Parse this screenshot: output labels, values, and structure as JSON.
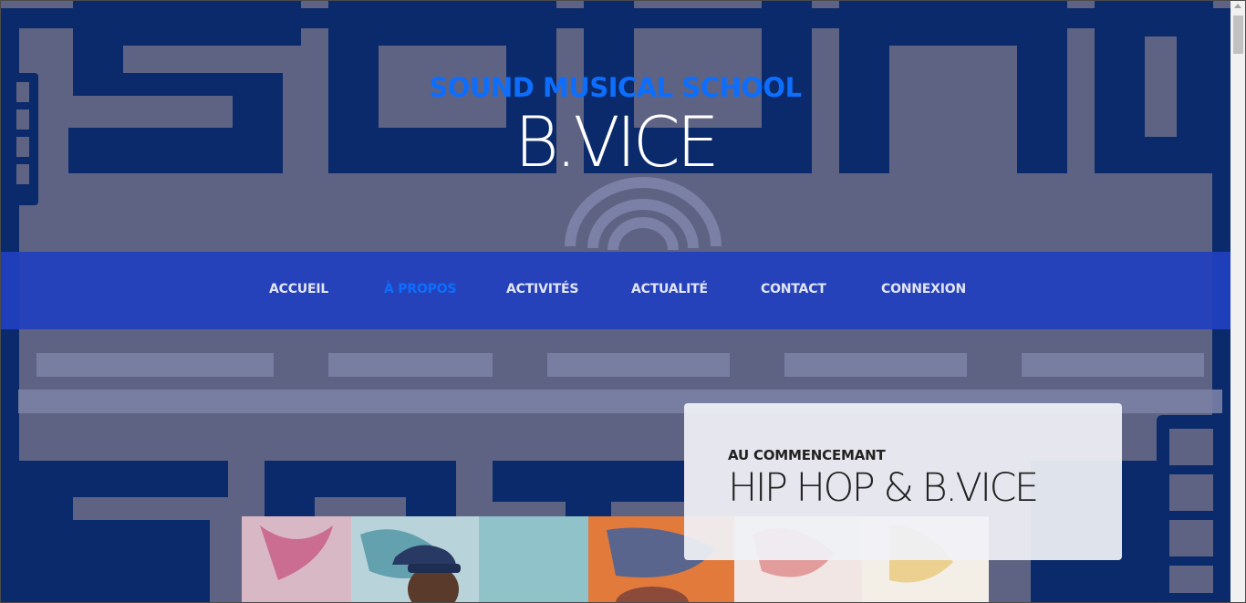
{
  "header": {
    "site_title": "SOUND MUSICAL SCHOOL",
    "brand": "B.VICE"
  },
  "nav": {
    "items": [
      {
        "label": "ACCUEIL",
        "active": false
      },
      {
        "label": "À PROPOS",
        "active": true
      },
      {
        "label": "ACTIVITÉS",
        "active": false
      },
      {
        "label": "ACTUALITÉ",
        "active": false
      },
      {
        "label": "CONTACT",
        "active": false
      },
      {
        "label": "CONNEXION",
        "active": false
      }
    ]
  },
  "card": {
    "kicker": "AU COMMENCEMANT",
    "title": "HIP HOP & B.VICE"
  },
  "icons": {
    "background_logo": "sound-school-logo-icon",
    "photo": "graffiti-photo-icon"
  },
  "colors": {
    "background": "#5f6383",
    "logo_navy": "#0a2a6b",
    "nav_bar": "#2140bf",
    "accent": "#0d6efd",
    "nav_text": "#e2e5f2",
    "card": "#f0f1f6"
  }
}
